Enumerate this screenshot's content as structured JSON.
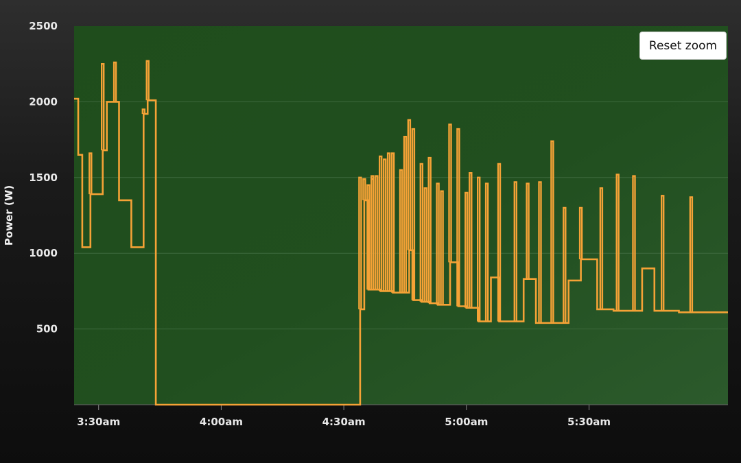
{
  "reset_zoom_label": "Reset zoom",
  "chart_data": {
    "type": "line",
    "title": "",
    "xlabel": "",
    "ylabel": "Power (W)",
    "ylim": [
      0,
      2500
    ],
    "xlim": [
      "3:24am",
      "6:04am"
    ],
    "yticks": [
      500,
      1000,
      1500,
      2000,
      2500
    ],
    "xticks": [
      "3:30am",
      "4:00am",
      "4:30am",
      "5:00am",
      "5:30am"
    ],
    "grid": true,
    "legend": "none",
    "colors": {
      "plot_bg": "#1d4a1d",
      "line": "#f5a236",
      "grid": "#3e6a3e"
    },
    "series": [
      {
        "x": [
          "3:24am",
          "3:25am",
          "3:25am",
          "3:26am",
          "3:26am",
          "3:28am",
          "3:28am",
          "3:31am",
          "3:31am",
          "3:32am",
          "3:32am",
          "3:35am",
          "3:35am",
          "3:36am",
          "3:36am",
          "3:38am",
          "3:38am",
          "3:41am",
          "3:41am",
          "3:42am",
          "3:42am",
          "3:43am",
          "3:43am",
          "3:44am",
          "3:44am",
          "4:34am",
          "4:34am",
          "4:35am",
          "4:35am",
          "4:36am",
          "4:36am",
          "4:37am",
          "4:37am",
          "4:39am",
          "4:39am",
          "4:42am",
          "4:42am",
          "4:46am",
          "4:46am",
          "4:47am",
          "4:47am",
          "4:49am",
          "4:49am",
          "4:51am",
          "4:51am",
          "4:53am",
          "4:53am",
          "4:56am",
          "4:56am",
          "4:58am",
          "4:58am",
          "5:00am",
          "5:00am",
          "5:03am",
          "5:03am",
          "5:06am",
          "5:06am",
          "5:08am",
          "5:08am",
          "5:09am",
          "5:09am",
          "5:12am",
          "5:12am",
          "5:14am",
          "5:14am",
          "5:17am",
          "5:17am",
          "5:20am",
          "5:20am",
          "5:23am",
          "5:23am",
          "5:25am",
          "5:25am",
          "5:28am",
          "5:28am",
          "5:32am",
          "5:32am",
          "5:34am",
          "5:34am",
          "5:36am",
          "5:36am",
          "5:39am",
          "5:39am",
          "5:43am",
          "5:43am",
          "5:46am",
          "5:46am",
          "5:49am",
          "5:49am",
          "5:52am",
          "5:52am",
          "5:57am",
          "5:57am",
          "6:04am"
        ],
        "y": [
          2020,
          2020,
          1650,
          1650,
          1040,
          1040,
          1390,
          1390,
          1680,
          1680,
          2000,
          2000,
          1350,
          1350,
          1350,
          1350,
          1040,
          1040,
          1920,
          1920,
          2010,
          2010,
          2010,
          2010,
          0,
          0,
          630,
          630,
          1350,
          1350,
          760,
          760,
          760,
          760,
          750,
          750,
          740,
          740,
          1020,
          1020,
          690,
          690,
          680,
          680,
          670,
          670,
          660,
          660,
          940,
          940,
          650,
          650,
          640,
          640,
          550,
          550,
          840,
          840,
          550,
          550,
          550,
          550,
          550,
          550,
          830,
          830,
          540,
          540,
          540,
          540,
          540,
          540,
          820,
          820,
          960,
          960,
          630,
          630,
          630,
          630,
          620,
          620,
          620,
          620,
          900,
          900,
          620,
          620,
          620,
          620,
          610,
          610,
          610,
          610
        ],
        "spikes": [
          {
            "x": "3:28am",
            "y": 1660
          },
          {
            "x": "3:31am",
            "y": 2250
          },
          {
            "x": "3:34am",
            "y": 2260
          },
          {
            "x": "3:41am",
            "y": 1950
          },
          {
            "x": "3:42am",
            "y": 2270
          },
          {
            "x": "4:34am",
            "y": 1500
          },
          {
            "x": "4:35am",
            "y": 1490
          },
          {
            "x": "4:36am",
            "y": 1450
          },
          {
            "x": "4:37am",
            "y": 1510
          },
          {
            "x": "4:37am",
            "y": 1490
          },
          {
            "x": "4:38am",
            "y": 1510
          },
          {
            "x": "4:39am",
            "y": 1640
          },
          {
            "x": "4:40am",
            "y": 1620
          },
          {
            "x": "4:41am",
            "y": 1660
          },
          {
            "x": "4:42am",
            "y": 1660
          },
          {
            "x": "4:44am",
            "y": 1550
          },
          {
            "x": "4:45am",
            "y": 1770
          },
          {
            "x": "4:46am",
            "y": 1880
          },
          {
            "x": "4:47am",
            "y": 1820
          },
          {
            "x": "4:49am",
            "y": 1590
          },
          {
            "x": "4:50am",
            "y": 1430
          },
          {
            "x": "4:51am",
            "y": 1630
          },
          {
            "x": "4:53am",
            "y": 1460
          },
          {
            "x": "4:54am",
            "y": 1410
          },
          {
            "x": "4:56am",
            "y": 1850
          },
          {
            "x": "4:58am",
            "y": 1820
          },
          {
            "x": "5:00am",
            "y": 1400
          },
          {
            "x": "5:01am",
            "y": 1530
          },
          {
            "x": "5:03am",
            "y": 1500
          },
          {
            "x": "5:05am",
            "y": 1460
          },
          {
            "x": "5:08am",
            "y": 1590
          },
          {
            "x": "5:12am",
            "y": 1470
          },
          {
            "x": "5:15am",
            "y": 1460
          },
          {
            "x": "5:18am",
            "y": 1470
          },
          {
            "x": "5:21am",
            "y": 1740
          },
          {
            "x": "5:24am",
            "y": 1300
          },
          {
            "x": "5:28am",
            "y": 1300
          },
          {
            "x": "5:33am",
            "y": 1430
          },
          {
            "x": "5:37am",
            "y": 1520
          },
          {
            "x": "5:41am",
            "y": 1510
          },
          {
            "x": "5:48am",
            "y": 1380
          },
          {
            "x": "5:55am",
            "y": 1370
          }
        ]
      }
    ]
  }
}
